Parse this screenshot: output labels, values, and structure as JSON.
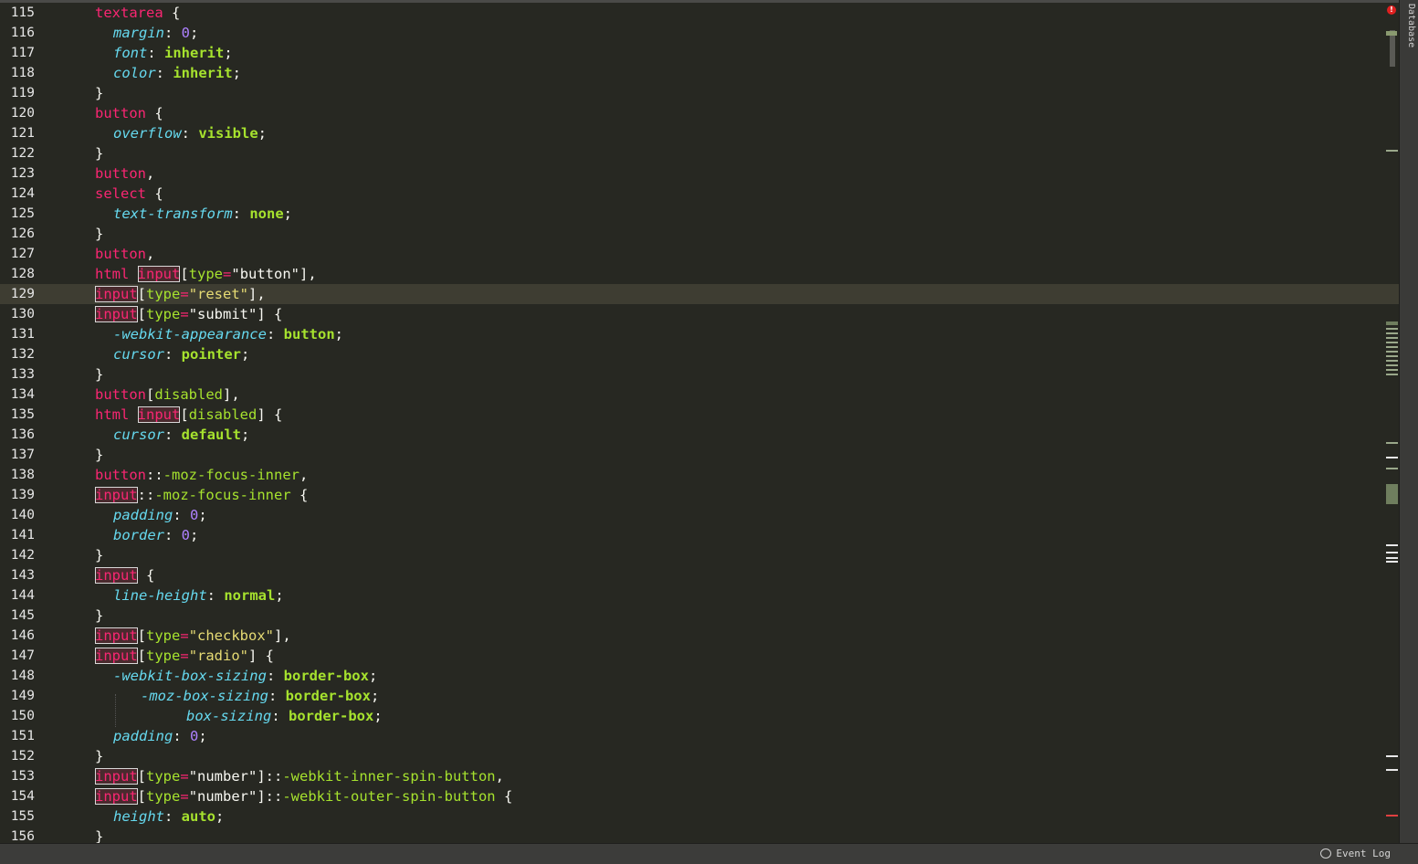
{
  "colors": {
    "background": "#272822",
    "selector": "#f92672",
    "property": "#66d9ef",
    "value": "#a6e22e",
    "number": "#ae81ff",
    "string": "#e6db74",
    "current_line": "#3e3d32"
  },
  "side_panel": {
    "tab_label": "Database"
  },
  "status_bar": {
    "event_log_label": "Event Log",
    "event_log_icon": "speech-bubble-icon"
  },
  "editor": {
    "current_line": 129,
    "lines": [
      {
        "n": "115",
        "ind": 0,
        "t": [
          [
            "sel",
            "textarea"
          ],
          [
            "punc",
            " {"
          ]
        ]
      },
      {
        "n": "116",
        "ind": 1,
        "t": [
          [
            "prop",
            "margin"
          ],
          [
            "punc",
            ": "
          ],
          [
            "num",
            "0"
          ],
          [
            "punc",
            ";"
          ]
        ]
      },
      {
        "n": "117",
        "ind": 1,
        "t": [
          [
            "prop",
            "font"
          ],
          [
            "punc",
            ": "
          ],
          [
            "val",
            "inherit"
          ],
          [
            "punc",
            ";"
          ]
        ]
      },
      {
        "n": "118",
        "ind": 1,
        "t": [
          [
            "prop",
            "color"
          ],
          [
            "punc",
            ": "
          ],
          [
            "val",
            "inherit"
          ],
          [
            "punc",
            ";"
          ]
        ]
      },
      {
        "n": "119",
        "ind": 0,
        "t": [
          [
            "punc",
            "}"
          ]
        ]
      },
      {
        "n": "120",
        "ind": 0,
        "t": [
          [
            "sel",
            "button"
          ],
          [
            "punc",
            " {"
          ]
        ]
      },
      {
        "n": "121",
        "ind": 1,
        "t": [
          [
            "prop",
            "overflow"
          ],
          [
            "punc",
            ": "
          ],
          [
            "val",
            "visible"
          ],
          [
            "punc",
            ";"
          ]
        ]
      },
      {
        "n": "122",
        "ind": 0,
        "t": [
          [
            "punc",
            "}"
          ]
        ]
      },
      {
        "n": "123",
        "ind": 0,
        "t": [
          [
            "sel",
            "button"
          ],
          [
            "punc",
            ","
          ]
        ]
      },
      {
        "n": "124",
        "ind": 0,
        "t": [
          [
            "sel",
            "select"
          ],
          [
            "punc",
            " {"
          ]
        ]
      },
      {
        "n": "125",
        "ind": 1,
        "t": [
          [
            "prop",
            "text-transform"
          ],
          [
            "punc",
            ": "
          ],
          [
            "val",
            "none"
          ],
          [
            "punc",
            ";"
          ]
        ]
      },
      {
        "n": "126",
        "ind": 0,
        "t": [
          [
            "punc",
            "}"
          ]
        ]
      },
      {
        "n": "127",
        "ind": 0,
        "t": [
          [
            "sel",
            "button"
          ],
          [
            "punc",
            ","
          ]
        ]
      },
      {
        "n": "128",
        "ind": 0,
        "t": [
          [
            "sel",
            "html "
          ],
          [
            "tag-input",
            "input"
          ],
          [
            "punc",
            "["
          ],
          [
            "attr",
            "type"
          ],
          [
            "eq",
            "="
          ],
          [
            "punc",
            "\"button\"],"
          ]
        ]
      },
      {
        "n": "129",
        "ind": 0,
        "t": [
          [
            "tag-input",
            "input"
          ],
          [
            "punc",
            "["
          ],
          [
            "attr",
            "type"
          ],
          [
            "eq",
            "="
          ],
          [
            "str",
            "\"reset\""
          ],
          [
            "punc",
            "],"
          ]
        ]
      },
      {
        "n": "130",
        "ind": 0,
        "t": [
          [
            "tag-input",
            "input"
          ],
          [
            "punc",
            "["
          ],
          [
            "attr",
            "type"
          ],
          [
            "eq",
            "="
          ],
          [
            "punc",
            "\"submit\"] {"
          ]
        ]
      },
      {
        "n": "131",
        "ind": 1,
        "t": [
          [
            "prop",
            "-webkit-appearance"
          ],
          [
            "punc",
            ": "
          ],
          [
            "val",
            "button"
          ],
          [
            "punc",
            ";"
          ]
        ]
      },
      {
        "n": "132",
        "ind": 1,
        "t": [
          [
            "prop",
            "cursor"
          ],
          [
            "punc",
            ": "
          ],
          [
            "val",
            "pointer"
          ],
          [
            "punc",
            ";"
          ]
        ]
      },
      {
        "n": "133",
        "ind": 0,
        "t": [
          [
            "punc",
            "}"
          ]
        ]
      },
      {
        "n": "134",
        "ind": 0,
        "t": [
          [
            "sel",
            "button"
          ],
          [
            "punc",
            "["
          ],
          [
            "attr",
            "disabled"
          ],
          [
            "punc",
            "],"
          ]
        ]
      },
      {
        "n": "135",
        "ind": 0,
        "t": [
          [
            "sel",
            "html "
          ],
          [
            "tag-input",
            "input"
          ],
          [
            "punc",
            "["
          ],
          [
            "attr",
            "disabled"
          ],
          [
            "punc",
            "] {"
          ]
        ]
      },
      {
        "n": "136",
        "ind": 1,
        "t": [
          [
            "prop",
            "cursor"
          ],
          [
            "punc",
            ": "
          ],
          [
            "val",
            "default"
          ],
          [
            "punc",
            ";"
          ]
        ]
      },
      {
        "n": "137",
        "ind": 0,
        "t": [
          [
            "punc",
            "}"
          ]
        ]
      },
      {
        "n": "138",
        "ind": 0,
        "t": [
          [
            "sel",
            "button"
          ],
          [
            "punc",
            "::"
          ],
          [
            "pseudo",
            "-moz-focus-inner"
          ],
          [
            "punc",
            ","
          ]
        ]
      },
      {
        "n": "139",
        "ind": 0,
        "t": [
          [
            "tag-input",
            "input"
          ],
          [
            "punc",
            "::"
          ],
          [
            "pseudo",
            "-moz-focus-inner"
          ],
          [
            "punc",
            " {"
          ]
        ]
      },
      {
        "n": "140",
        "ind": 1,
        "t": [
          [
            "prop",
            "padding"
          ],
          [
            "punc",
            ": "
          ],
          [
            "num",
            "0"
          ],
          [
            "punc",
            ";"
          ]
        ]
      },
      {
        "n": "141",
        "ind": 1,
        "t": [
          [
            "prop",
            "border"
          ],
          [
            "punc",
            ": "
          ],
          [
            "num",
            "0"
          ],
          [
            "punc",
            ";"
          ]
        ]
      },
      {
        "n": "142",
        "ind": 0,
        "t": [
          [
            "punc",
            "}"
          ]
        ]
      },
      {
        "n": "143",
        "ind": 0,
        "t": [
          [
            "tag-input",
            "input"
          ],
          [
            "punc",
            " {"
          ]
        ]
      },
      {
        "n": "144",
        "ind": 1,
        "t": [
          [
            "prop",
            "line-height"
          ],
          [
            "punc",
            ": "
          ],
          [
            "val",
            "normal"
          ],
          [
            "punc",
            ";"
          ]
        ]
      },
      {
        "n": "145",
        "ind": 0,
        "t": [
          [
            "punc",
            "}"
          ]
        ]
      },
      {
        "n": "146",
        "ind": 0,
        "t": [
          [
            "tag-input",
            "input"
          ],
          [
            "punc",
            "["
          ],
          [
            "attr",
            "type"
          ],
          [
            "eq",
            "="
          ],
          [
            "str",
            "\"checkbox\""
          ],
          [
            "punc",
            "],"
          ]
        ]
      },
      {
        "n": "147",
        "ind": 0,
        "t": [
          [
            "tag-input",
            "input"
          ],
          [
            "punc",
            "["
          ],
          [
            "attr",
            "type"
          ],
          [
            "eq",
            "="
          ],
          [
            "str",
            "\"radio\""
          ],
          [
            "punc",
            "] {"
          ]
        ]
      },
      {
        "n": "148",
        "ind": 1,
        "t": [
          [
            "prop",
            "-webkit-box-sizing"
          ],
          [
            "punc",
            ": "
          ],
          [
            "val",
            "border-box"
          ],
          [
            "punc",
            ";"
          ]
        ]
      },
      {
        "n": "149",
        "ind": 4,
        "t": [
          [
            "prop",
            "-moz-box-sizing"
          ],
          [
            "punc",
            ": "
          ],
          [
            "val",
            "border-box"
          ],
          [
            "punc",
            ";"
          ]
        ]
      },
      {
        "n": "150",
        "ind": 9,
        "t": [
          [
            "prop",
            "box-sizing"
          ],
          [
            "punc",
            ": "
          ],
          [
            "val",
            "border-box"
          ],
          [
            "punc",
            ";"
          ]
        ]
      },
      {
        "n": "151",
        "ind": 1,
        "t": [
          [
            "prop",
            "padding"
          ],
          [
            "punc",
            ": "
          ],
          [
            "num",
            "0"
          ],
          [
            "punc",
            ";"
          ]
        ]
      },
      {
        "n": "152",
        "ind": 0,
        "t": [
          [
            "punc",
            "}"
          ]
        ]
      },
      {
        "n": "153",
        "ind": 0,
        "t": [
          [
            "tag-input",
            "input"
          ],
          [
            "punc",
            "["
          ],
          [
            "attr",
            "type"
          ],
          [
            "eq",
            "="
          ],
          [
            "punc",
            "\"number\"]::"
          ],
          [
            "pseudo",
            "-webkit-inner-spin-button"
          ],
          [
            "punc",
            ","
          ]
        ]
      },
      {
        "n": "154",
        "ind": 0,
        "t": [
          [
            "tag-input",
            "input"
          ],
          [
            "punc",
            "["
          ],
          [
            "attr",
            "type"
          ],
          [
            "eq",
            "="
          ],
          [
            "punc",
            "\"number\"]::"
          ],
          [
            "pseudo",
            "-webkit-outer-spin-button"
          ],
          [
            "punc",
            " {"
          ]
        ]
      },
      {
        "n": "155",
        "ind": 1,
        "t": [
          [
            "prop",
            "height"
          ],
          [
            "punc",
            ": "
          ],
          [
            "val",
            "auto"
          ],
          [
            "punc",
            ";"
          ]
        ]
      },
      {
        "n": "156",
        "ind": 0,
        "t": [
          [
            "punc",
            "}"
          ]
        ]
      }
    ]
  }
}
